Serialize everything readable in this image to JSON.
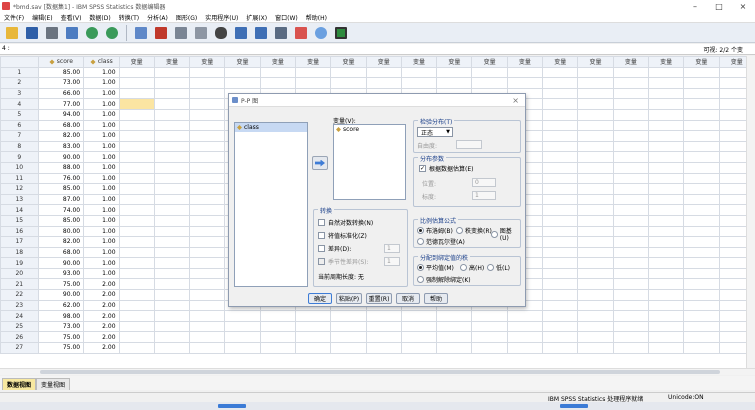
{
  "window": {
    "title": "*bmd.sav [数据集1] - IBM SPSS Statistics 数据编辑器"
  },
  "menu": [
    "文件(F)",
    "编辑(E)",
    "查看(V)",
    "数据(D)",
    "转换(T)",
    "分析(A)",
    "图形(G)",
    "实用程序(U)",
    "扩展(X)",
    "窗口(W)",
    "帮助(H)"
  ],
  "varbar": {
    "cell_ref": "4 :",
    "visible": "可视: 2/2 个变"
  },
  "grid": {
    "columns": [
      "score",
      "class",
      "变量",
      "变量",
      "变量",
      "变量",
      "变量",
      "变量",
      "变量",
      "变量",
      "变量",
      "变量",
      "变量",
      "变量",
      "变量",
      "变量",
      "变量",
      "变量",
      "变量",
      "变量"
    ],
    "rows": [
      [
        "85.00",
        "1.00"
      ],
      [
        "73.00",
        "1.00"
      ],
      [
        "66.00",
        "1.00"
      ],
      [
        "77.00",
        "1.00"
      ],
      [
        "94.00",
        "1.00"
      ],
      [
        "68.00",
        "1.00"
      ],
      [
        "82.00",
        "1.00"
      ],
      [
        "83.00",
        "1.00"
      ],
      [
        "90.00",
        "1.00"
      ],
      [
        "88.00",
        "1.00"
      ],
      [
        "76.00",
        "1.00"
      ],
      [
        "85.00",
        "1.00"
      ],
      [
        "87.00",
        "1.00"
      ],
      [
        "74.00",
        "1.00"
      ],
      [
        "85.00",
        "1.00"
      ],
      [
        "80.00",
        "1.00"
      ],
      [
        "82.00",
        "1.00"
      ],
      [
        "68.00",
        "1.00"
      ],
      [
        "90.00",
        "1.00"
      ],
      [
        "93.00",
        "1.00"
      ],
      [
        "75.00",
        "2.00"
      ],
      [
        "90.00",
        "2.00"
      ],
      [
        "62.00",
        "2.00"
      ],
      [
        "98.00",
        "2.00"
      ],
      [
        "73.00",
        "2.00"
      ],
      [
        "75.00",
        "2.00"
      ],
      [
        "75.00",
        "2.00"
      ]
    ]
  },
  "tabs": [
    "数据视图",
    "变量视图"
  ],
  "status": {
    "processor": "IBM SPSS Statistics 处理程序就绪",
    "unicode": "Unicode:ON"
  },
  "dialog": {
    "title": "P-P 图",
    "source_vars": [
      "class"
    ],
    "target_label": "变量(V):",
    "target_vars": [
      "score"
    ],
    "transform": {
      "title": "转换",
      "natural_log": "自然对数转换(N)",
      "standardize": "将值标准化(Z)",
      "difference": "差异(D):",
      "difference_value": "1",
      "seasonal": "季节性差异(S):",
      "seasonal_value": "1",
      "period": "当前周期长度: 无"
    },
    "test_dist": {
      "title": "检验分布(T)",
      "selected": "正态",
      "df_label": "自由度:"
    },
    "params": {
      "title": "分布参数",
      "estimate": "根据数据估算(E)",
      "location_label": "位置:",
      "location_value": "0",
      "scale_label": "标度:",
      "scale_value": "1"
    },
    "proportion": {
      "title": "比例估算公式",
      "options": [
        "布洛姆(B)",
        "秩变换(R)",
        "图基(U)",
        "范德瓦尔登(A)"
      ]
    },
    "ties": {
      "title": "分配到绑定值的秩",
      "options": [
        "平均值(M)",
        "高(H)",
        "低(L)",
        "强制解除绑定(K)"
      ]
    },
    "buttons": [
      "确定",
      "粘贴(P)",
      "重置(R)",
      "取消",
      "帮助"
    ]
  }
}
